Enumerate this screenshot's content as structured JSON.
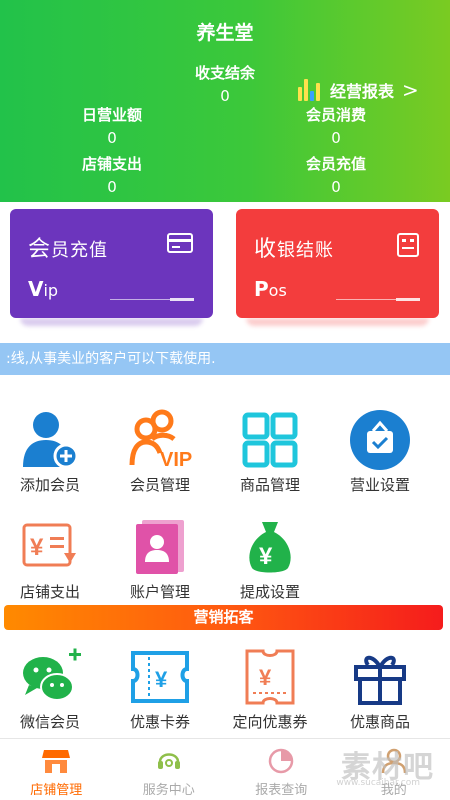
{
  "header": {
    "title": "养生堂",
    "balance": {
      "label": "收支结余",
      "value": "0"
    },
    "report_link": "经营报表",
    "report_chevron": ">",
    "daily_revenue": {
      "label": "日营业额",
      "value": "0"
    },
    "member_consume": {
      "label": "会员消费",
      "value": "0"
    },
    "store_expense": {
      "label": "店铺支出",
      "value": "0"
    },
    "member_recharge": {
      "label": "会员充值",
      "value": "0"
    }
  },
  "cards": {
    "recharge": {
      "title_big": "会",
      "title_rest": "员充值",
      "code_initial": "V",
      "code_rest": "ip",
      "color": "#6c35bd"
    },
    "cashier": {
      "title_big": "收",
      "title_rest": "银结账",
      "code_initial": "P",
      "code_rest": "os",
      "color": "#f33d3d"
    }
  },
  "notice": ":线,从事美业的客户可以下载使用.",
  "grid": [
    {
      "label": "添加会员",
      "icon": "add-member-icon"
    },
    {
      "label": "会员管理",
      "icon": "vip-member-icon"
    },
    {
      "label": "商品管理",
      "icon": "product-grid-icon"
    },
    {
      "label": "营业设置",
      "icon": "business-settings-icon"
    },
    {
      "label": "店铺支出",
      "icon": "store-expense-icon"
    },
    {
      "label": "账户管理",
      "icon": "account-manage-icon"
    },
    {
      "label": "提成设置",
      "icon": "commission-bag-icon"
    }
  ],
  "marketing_banner": "营销拓客",
  "marketing": [
    {
      "label": "微信会员",
      "icon": "wechat-icon"
    },
    {
      "label": "优惠卡券",
      "icon": "coupon-ticket-icon"
    },
    {
      "label": "定向优惠券",
      "icon": "targeted-coupon-icon"
    },
    {
      "label": "优惠商品",
      "icon": "gift-box-icon"
    }
  ],
  "nav": [
    {
      "label": "店铺管理",
      "active": true
    },
    {
      "label": "服务中心",
      "active": false
    },
    {
      "label": "报表查询",
      "active": false
    },
    {
      "label": "我的",
      "active": false
    }
  ],
  "watermark": "素材吧",
  "watermark_sub": "www.sucaibar.com",
  "colors": {
    "header_green": "#22c24a",
    "accent_orange": "#ff6a00",
    "icon_blue": "#1b7fd0",
    "icon_cyan": "#1fc6dc",
    "icon_salmon": "#f07d55",
    "icon_pink": "#e052a8",
    "icon_green": "#21b24a",
    "icon_navy": "#173a86"
  }
}
